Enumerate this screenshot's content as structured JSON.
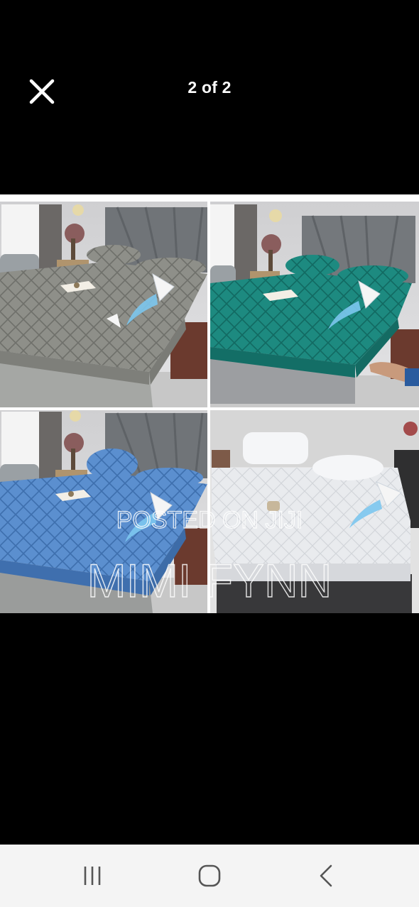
{
  "viewer": {
    "counter_text": "2 of 2",
    "close_icon": "close-icon"
  },
  "photo": {
    "watermark_line1": "POSTED ON JIJI",
    "watermark_line2": "MIMI FYNN",
    "panels": [
      {
        "position": "top-left",
        "color_name": "grey",
        "color": "#8e8f89"
      },
      {
        "position": "top-right",
        "color_name": "teal",
        "color": "#1d8a80"
      },
      {
        "position": "bottom-left",
        "color_name": "blue",
        "color": "#5b8fcf"
      },
      {
        "position": "bottom-right",
        "color_name": "white",
        "color": "#e9ebee"
      }
    ]
  },
  "system_nav": {
    "recents_icon": "recent-apps-icon",
    "home_icon": "home-icon",
    "back_icon": "back-icon"
  }
}
